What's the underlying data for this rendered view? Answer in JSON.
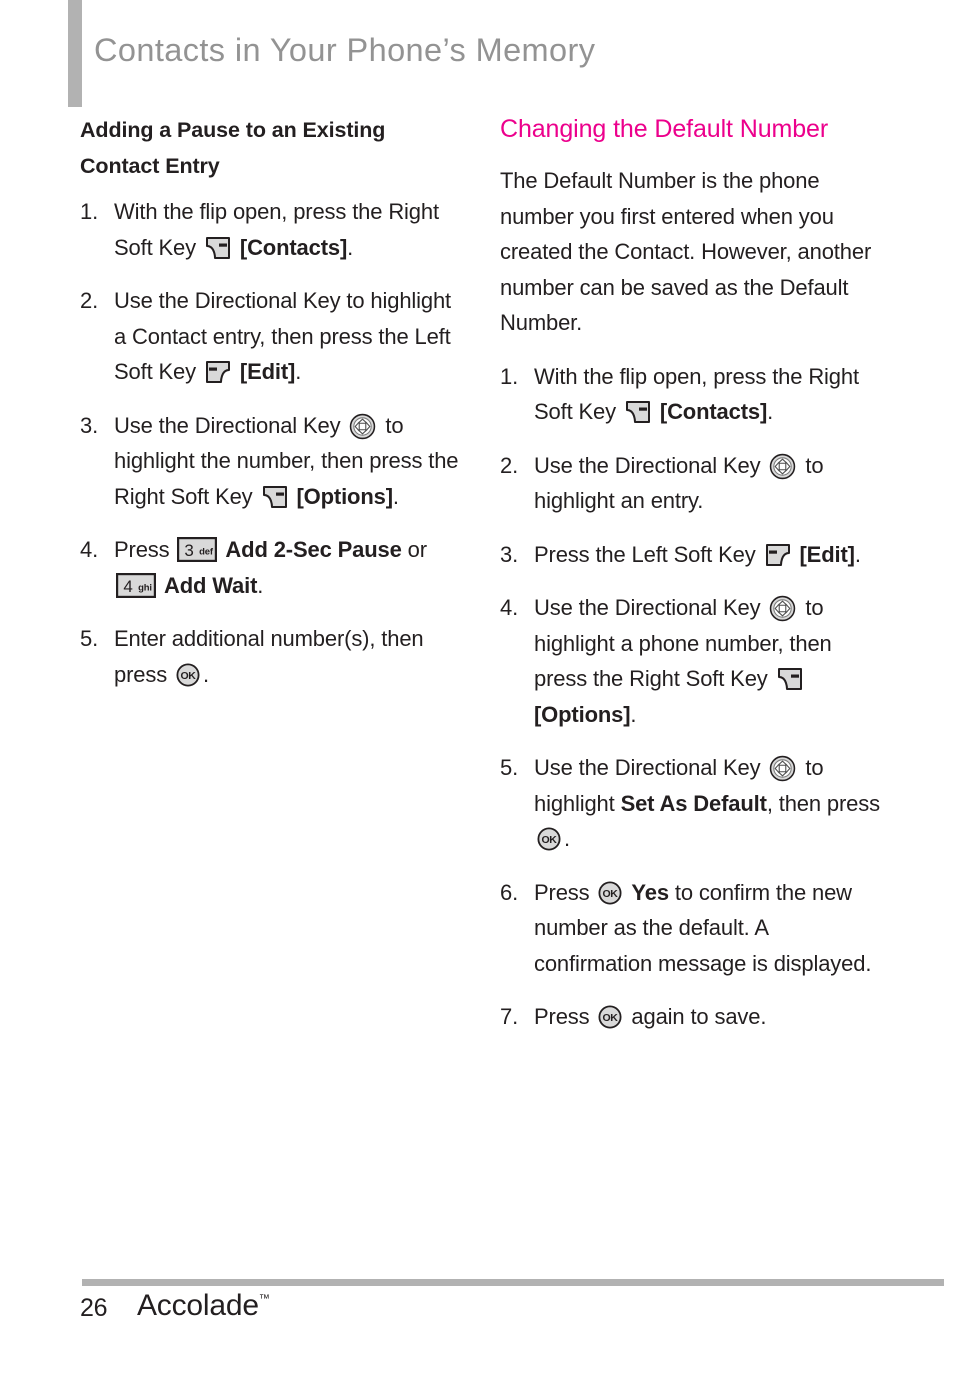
{
  "page": {
    "title": "Contacts in Your Phone’s Memory",
    "accent_color": "#ec008c",
    "rule_color": "#b2b2b2",
    "text_color": "#231f20"
  },
  "left_column": {
    "heading": "Adding a Pause to an Existing Contact Entry",
    "steps": [
      {
        "number": "1.",
        "parts": [
          {
            "type": "text",
            "value": "With the flip open, press the Right Soft Key "
          },
          {
            "type": "icon",
            "icon": "right-soft-key-icon"
          },
          {
            "type": "text",
            "value": " "
          },
          {
            "type": "bold",
            "value": "[Contacts]"
          },
          {
            "type": "text",
            "value": "."
          }
        ]
      },
      {
        "number": "2.",
        "parts": [
          {
            "type": "text",
            "value": "Use the Directional Key to highlight a Contact entry, then press the Left Soft Key "
          },
          {
            "type": "icon",
            "icon": "left-soft-key-icon"
          },
          {
            "type": "text",
            "value": " "
          },
          {
            "type": "bold",
            "value": "[Edit]"
          },
          {
            "type": "text",
            "value": "."
          }
        ]
      },
      {
        "number": "3.",
        "parts": [
          {
            "type": "text",
            "value": "Use the Directional Key "
          },
          {
            "type": "icon",
            "icon": "directional-key-icon"
          },
          {
            "type": "text",
            "value": " to highlight the number, then press the Right Soft Key "
          },
          {
            "type": "icon",
            "icon": "right-soft-key-icon"
          },
          {
            "type": "text",
            "value": " "
          },
          {
            "type": "bold",
            "value": "[Options]"
          },
          {
            "type": "text",
            "value": "."
          }
        ]
      },
      {
        "number": "4.",
        "parts": [
          {
            "type": "text",
            "value": "Press "
          },
          {
            "type": "icon",
            "icon": "key-3-def-icon"
          },
          {
            "type": "text",
            "value": " "
          },
          {
            "type": "bold",
            "value": "Add 2-Sec Pause"
          },
          {
            "type": "text",
            "value": " or "
          },
          {
            "type": "icon",
            "icon": "key-4-ghi-icon"
          },
          {
            "type": "text",
            "value": " "
          },
          {
            "type": "bold",
            "value": "Add Wait"
          },
          {
            "type": "text",
            "value": "."
          }
        ]
      },
      {
        "number": "5.",
        "parts": [
          {
            "type": "text",
            "value": "Enter additional number(s), then press "
          },
          {
            "type": "icon",
            "icon": "ok-key-icon"
          },
          {
            "type": "text",
            "value": "."
          }
        ]
      }
    ]
  },
  "right_column": {
    "heading": "Changing the Default Number",
    "intro": "The Default Number is the phone number you first entered when you created the Contact. However, another number can be saved as the Default Number.",
    "steps": [
      {
        "number": "1.",
        "parts": [
          {
            "type": "text",
            "value": "With the flip open, press the Right Soft Key "
          },
          {
            "type": "icon",
            "icon": "right-soft-key-icon"
          },
          {
            "type": "text",
            "value": " "
          },
          {
            "type": "bold",
            "value": "[Contacts]"
          },
          {
            "type": "text",
            "value": "."
          }
        ]
      },
      {
        "number": "2.",
        "parts": [
          {
            "type": "text",
            "value": "Use the Directional Key "
          },
          {
            "type": "icon",
            "icon": "directional-key-icon"
          },
          {
            "type": "text",
            "value": " to highlight an entry."
          }
        ]
      },
      {
        "number": "3.",
        "parts": [
          {
            "type": "text",
            "value": "Press the Left Soft Key "
          },
          {
            "type": "icon",
            "icon": "left-soft-key-icon"
          },
          {
            "type": "text",
            "value": " "
          },
          {
            "type": "bold",
            "value": "[Edit]"
          },
          {
            "type": "text",
            "value": "."
          }
        ]
      },
      {
        "number": "4.",
        "parts": [
          {
            "type": "text",
            "value": "Use the Directional Key "
          },
          {
            "type": "icon",
            "icon": "directional-key-icon"
          },
          {
            "type": "text",
            "value": " to highlight a phone number, then press the Right Soft Key "
          },
          {
            "type": "icon",
            "icon": "right-soft-key-icon"
          },
          {
            "type": "text",
            "value": " "
          },
          {
            "type": "bold",
            "value": "[Options]"
          },
          {
            "type": "text",
            "value": "."
          }
        ]
      },
      {
        "number": "5.",
        "parts": [
          {
            "type": "text",
            "value": "Use the Directional Key "
          },
          {
            "type": "icon",
            "icon": "directional-key-icon"
          },
          {
            "type": "text",
            "value": " to highlight "
          },
          {
            "type": "bold",
            "value": "Set As Default"
          },
          {
            "type": "text",
            "value": ", then press "
          },
          {
            "type": "icon",
            "icon": "ok-key-icon"
          },
          {
            "type": "text",
            "value": "."
          }
        ]
      },
      {
        "number": "6.",
        "parts": [
          {
            "type": "text",
            "value": "Press "
          },
          {
            "type": "icon",
            "icon": "ok-key-icon"
          },
          {
            "type": "text",
            "value": " "
          },
          {
            "type": "bold",
            "value": "Yes"
          },
          {
            "type": "text",
            "value": " to confirm the new number as the default. A confirmation message is displayed."
          }
        ]
      },
      {
        "number": "7.",
        "parts": [
          {
            "type": "text",
            "value": "Press "
          },
          {
            "type": "icon",
            "icon": "ok-key-icon"
          },
          {
            "type": "text",
            "value": " again to save."
          }
        ]
      }
    ]
  },
  "footer": {
    "page_number": "26",
    "brand": "Accolade",
    "trademark": "™"
  }
}
